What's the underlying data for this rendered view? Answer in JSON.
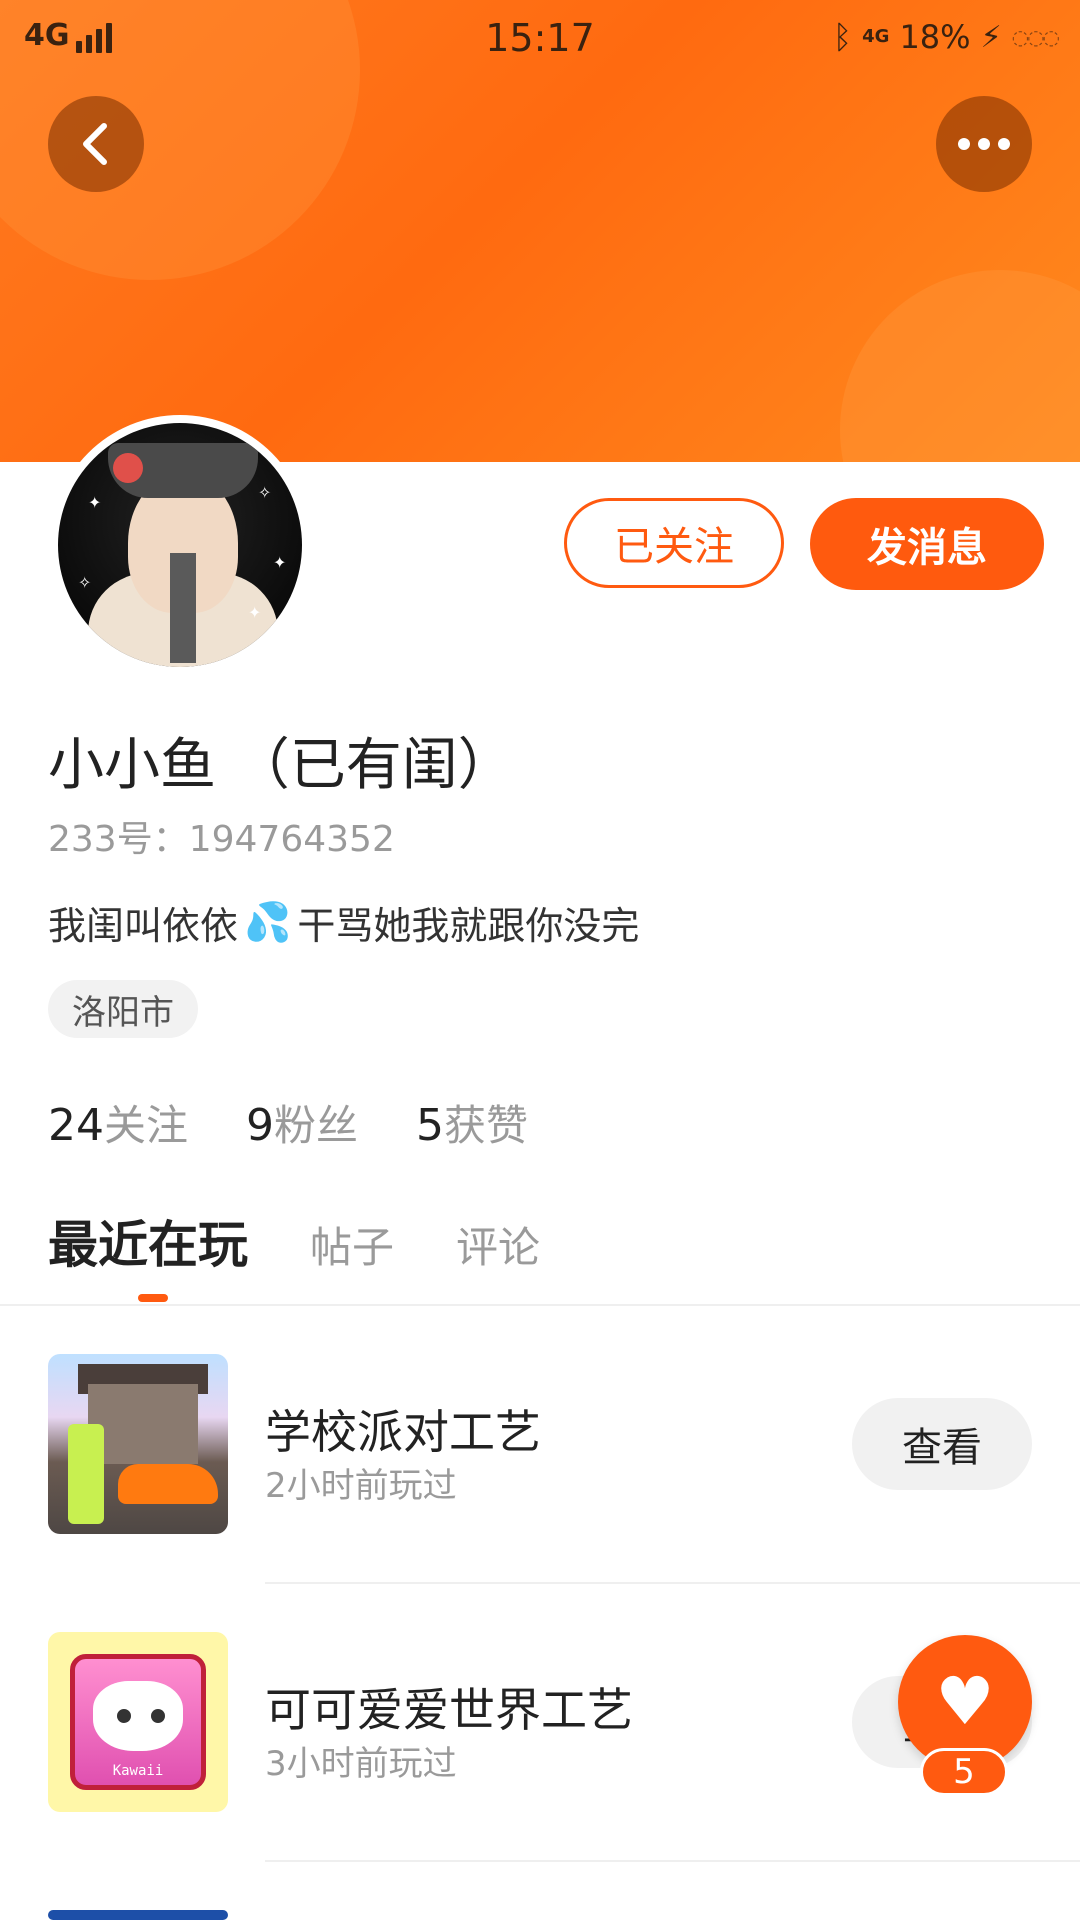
{
  "status_bar": {
    "network_left": "4G",
    "time": "15:17",
    "network_right": "4G",
    "battery": "18%"
  },
  "profile": {
    "name": "小小鱼 （已有闺）",
    "id_label": "233号：",
    "id_value": "194764352",
    "bio_before": "我闺叫依依",
    "bio_emoji": "💦",
    "bio_after": " 干骂她我就跟你没完",
    "location": "洛阳市"
  },
  "actions": {
    "followed_label": "已关注",
    "message_label": "发消息"
  },
  "stats": [
    {
      "num": "24",
      "label": "关注"
    },
    {
      "num": "9",
      "label": "粉丝"
    },
    {
      "num": "5",
      "label": "获赞"
    }
  ],
  "tabs": [
    {
      "label": "最近在玩",
      "active": true
    },
    {
      "label": "帖子",
      "active": false
    },
    {
      "label": "评论",
      "active": false
    }
  ],
  "games": [
    {
      "name": "学校派对工艺",
      "time": "2小时前玩过",
      "button": "查看"
    },
    {
      "name": "可可爱爱世界工艺",
      "time": "3小时前玩过",
      "button": "查看",
      "thumb_text": "Kawaii"
    }
  ],
  "like_fab": {
    "count": "5"
  },
  "colors": {
    "accent": "#ff5a10",
    "banner": "#ff7a1f"
  }
}
